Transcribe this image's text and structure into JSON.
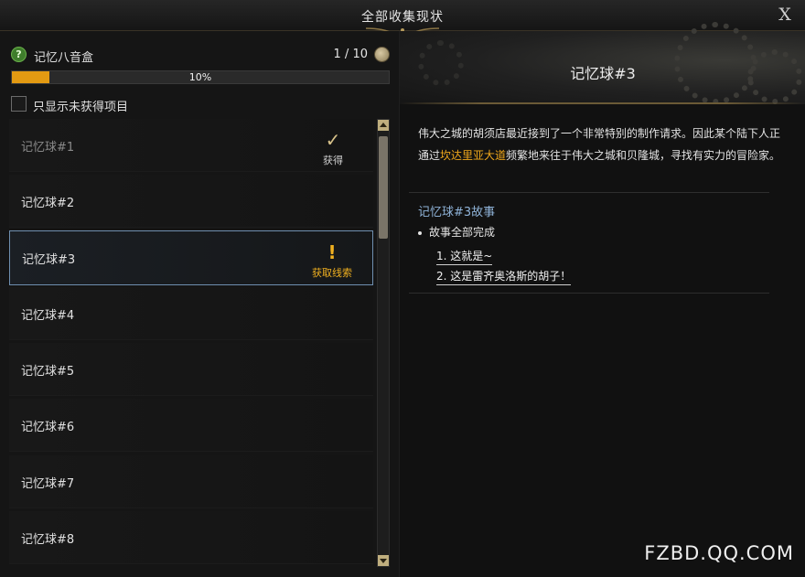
{
  "window": {
    "title": "全部收集现状",
    "close_label": "X"
  },
  "collection": {
    "name": "记忆八音盒",
    "help_label": "?",
    "count": "1 / 10",
    "progress_value": 0.1,
    "progress_label": "10%"
  },
  "filter": {
    "label": "只显示未获得项目",
    "checked": false
  },
  "list": {
    "items": [
      {
        "label": "记忆球#1",
        "status": "obtained",
        "status_mark": "✓",
        "status_text": "获得"
      },
      {
        "label": "记忆球#2",
        "status": "none"
      },
      {
        "label": "记忆球#3",
        "status": "clue",
        "status_mark": "!",
        "status_text": "获取线索",
        "selected": true
      },
      {
        "label": "记忆球#4",
        "status": "none"
      },
      {
        "label": "记忆球#5",
        "status": "none"
      },
      {
        "label": "记忆球#6",
        "status": "none"
      },
      {
        "label": "记忆球#7",
        "status": "none"
      },
      {
        "label": "记忆球#8",
        "status": "none"
      }
    ]
  },
  "detail": {
    "title": "记忆球#3",
    "desc_part1": "伟大之城的胡须店最近接到了一个非常特别的制作请求。因此某个陆下人正通过",
    "desc_highlight": "坎达里亚大道",
    "desc_part2": "频繁地来往于伟大之城和贝隆城，寻找有实力的冒险家。",
    "highlight_color": "#f0a81c",
    "story_title": "记忆球#3故事",
    "story_status": "故事全部完成",
    "story_links": [
      "1. 这就是~",
      "2. 这是雷齐奥洛斯的胡子！"
    ]
  },
  "watermark": "FZBD.QQ.COM",
  "colors": {
    "progress": "#e39a12",
    "clue": "#f0b020",
    "story_title": "#8fb3d8",
    "selected_border": "#6f8fb0"
  }
}
